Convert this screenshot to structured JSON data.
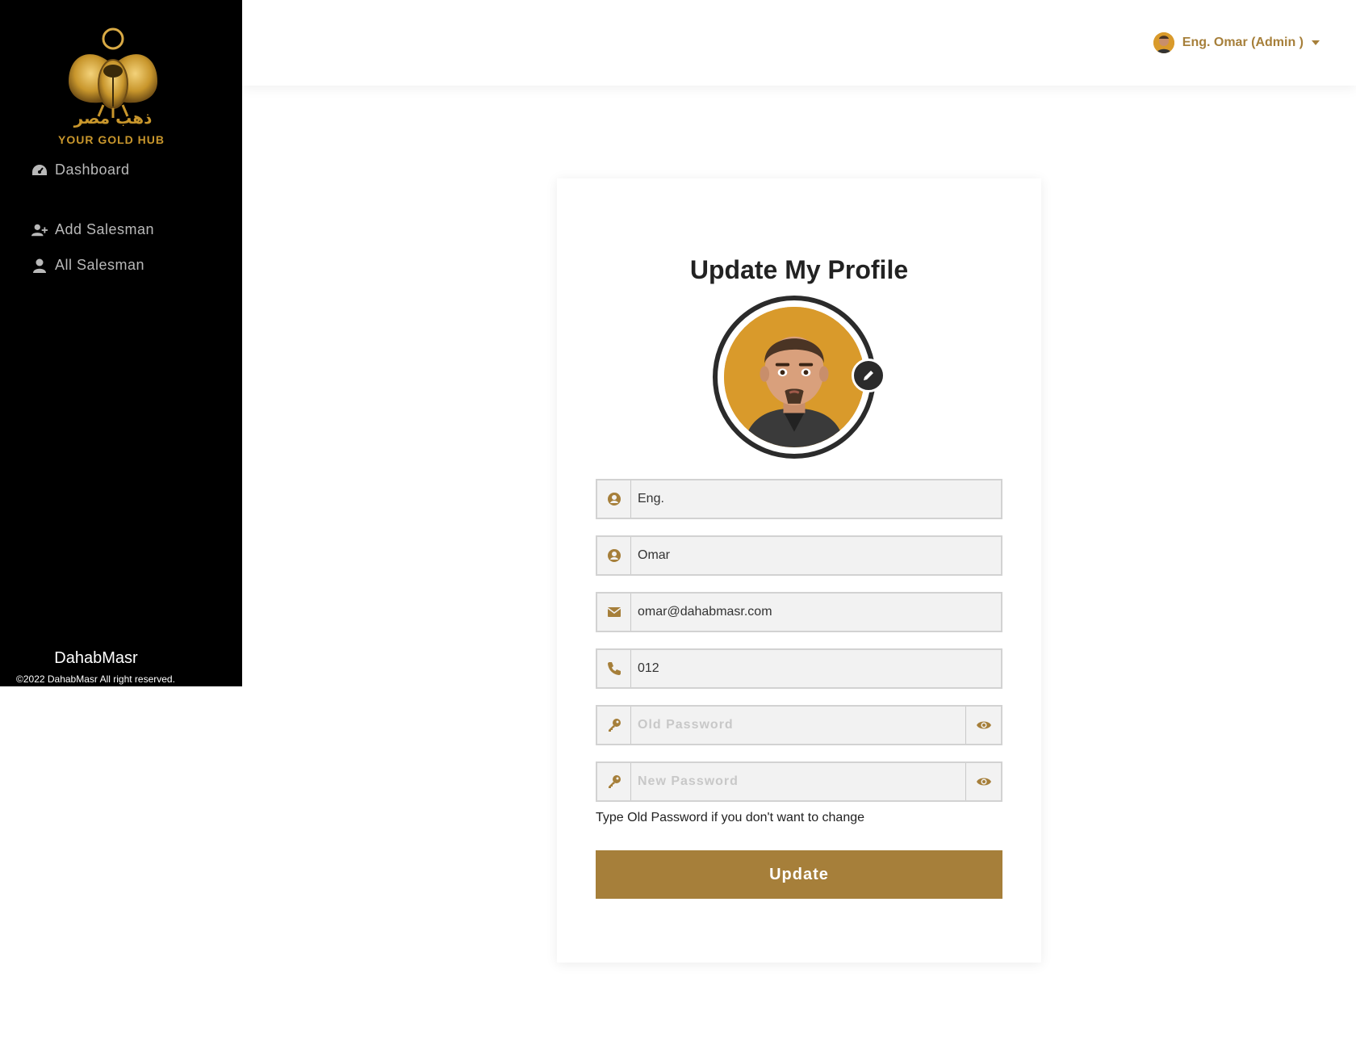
{
  "colors": {
    "sidebar_bg": "#000000",
    "accent_gold": "#a67f3a",
    "avatar_bg": "#d99a2b"
  },
  "logo": {
    "arabic_text": "ذهب مصر",
    "tagline": "YOUR GOLD HUB"
  },
  "sidebar": {
    "items": [
      {
        "label": "Dashboard",
        "icon": "gauge-icon"
      },
      {
        "label": "Add Salesman",
        "icon": "user-plus-icon"
      },
      {
        "label": "All Salesman",
        "icon": "user-icon"
      }
    ],
    "brand": "DahabMasr",
    "copyright": "©2022 DahabMasr All right reserved."
  },
  "header": {
    "user_label": "Eng. Omar (Admin )"
  },
  "profile": {
    "title": "Update My Profile",
    "fields": {
      "title_value": "Eng.",
      "name_value": "Omar",
      "email_value": "omar@dahabmasr.com",
      "phone_value": "012",
      "old_password_placeholder": "Old Password",
      "new_password_placeholder": "New Password"
    },
    "hint": "Type Old Password if you don't want to change",
    "submit_label": "Update"
  }
}
